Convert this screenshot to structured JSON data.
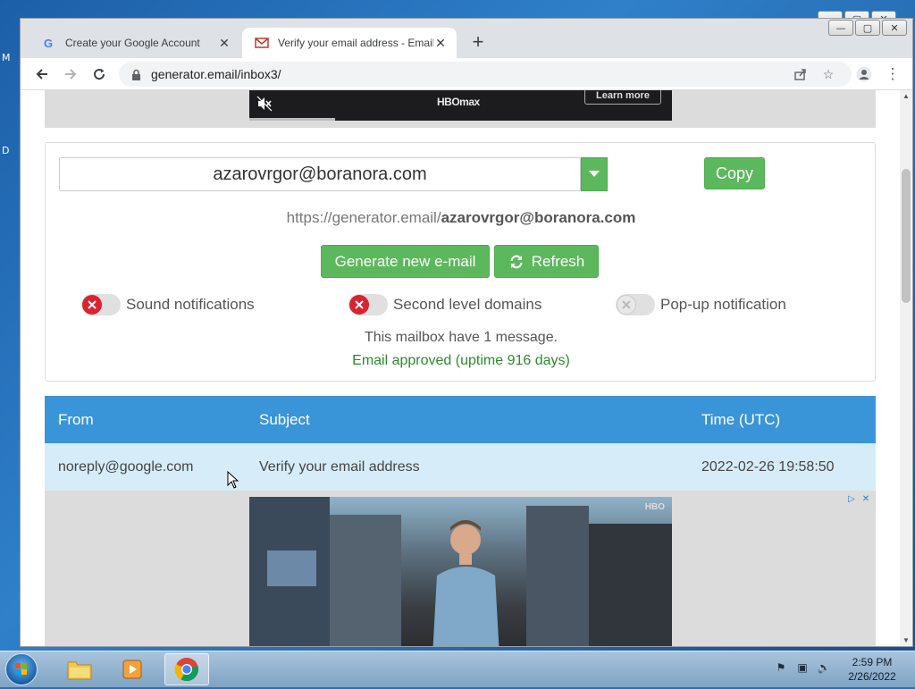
{
  "desktop": {
    "edge_letters": [
      "M",
      "D"
    ]
  },
  "browser": {
    "tabs": [
      {
        "title": "Create your Google Account",
        "active": false
      },
      {
        "title": "Verify your email address - Email",
        "active": true
      }
    ],
    "new_tab_label": "+",
    "url": "generator.email/inbox3/"
  },
  "ad_top": {
    "brand": "HBOmax",
    "cta": "Learn more"
  },
  "mailbox": {
    "email": "azarovrgor@boranora.com",
    "copy_label": "Copy",
    "url_prefix": "https://generator.email/",
    "url_email": "azarovrgor@boranora.com",
    "generate_label": "Generate new e-mail",
    "refresh_label": "Refresh",
    "toggles": [
      {
        "label": "Sound notifications",
        "state": "off"
      },
      {
        "label": "Second level domains",
        "state": "off"
      },
      {
        "label": "Pop-up notification",
        "state": "disabled"
      }
    ],
    "count_text": "This mailbox have 1 message.",
    "approved_text": "Email approved (uptime 916 days)"
  },
  "inbox": {
    "columns": [
      "From",
      "Subject",
      "Time (UTC)"
    ],
    "rows": [
      {
        "from": "noreply@google.com",
        "subject": "Verify your email address",
        "time": "2022-02-26 19:58:50"
      }
    ]
  },
  "ad_bottom": {
    "brand": "HBO"
  },
  "taskbar": {
    "time": "2:59 PM",
    "date": "2/26/2022"
  },
  "colors": {
    "green": "#5cb85c",
    "table_header": "#3a95d8",
    "table_row": "#d6ecf8",
    "approved": "#2d8a2d",
    "toggle_red": "#d9232e"
  }
}
